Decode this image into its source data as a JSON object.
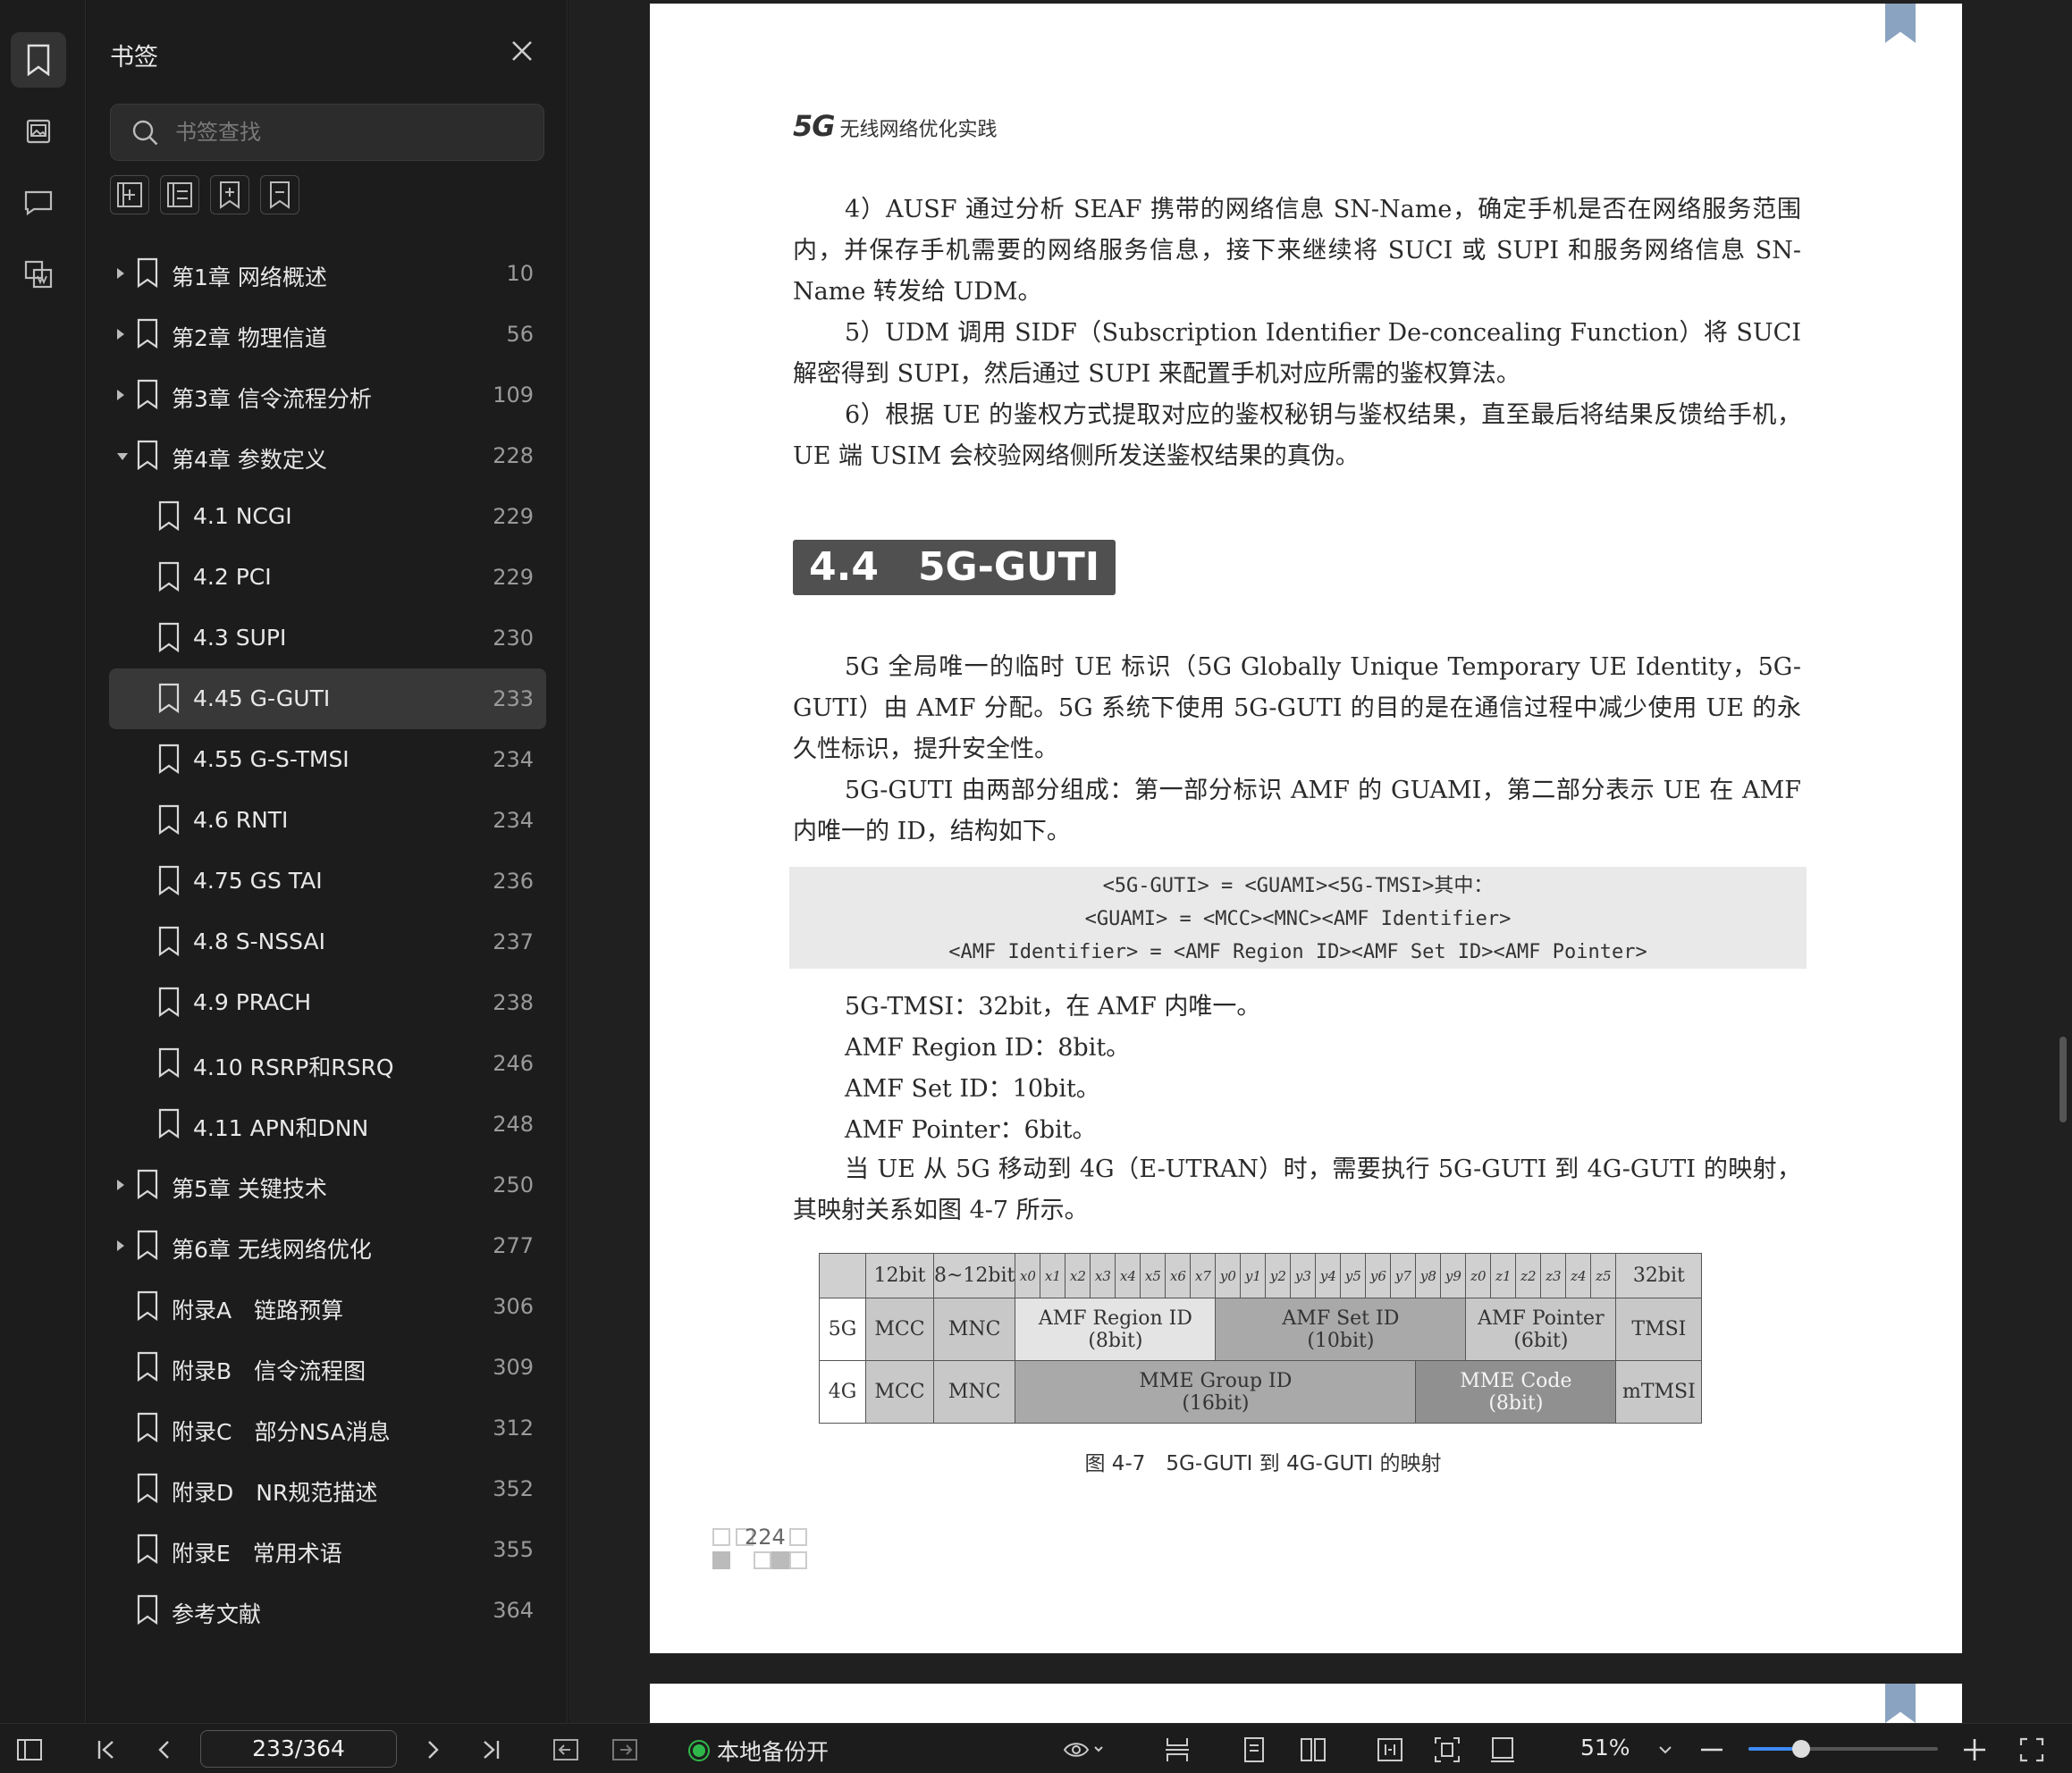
{
  "sidebar": {
    "title": "书签",
    "search_placeholder": "书签查找",
    "items": [
      {
        "label": "第1章 网络概述",
        "page": "10",
        "level": 0,
        "arrow": "right"
      },
      {
        "label": "第2章 物理信道",
        "page": "56",
        "level": 0,
        "arrow": "right"
      },
      {
        "label": "第3章 信令流程分析",
        "page": "109",
        "level": 0,
        "arrow": "right"
      },
      {
        "label": "第4章 参数定义",
        "page": "228",
        "level": 0,
        "arrow": "down"
      },
      {
        "label": "4.1 NCGI",
        "page": "229",
        "level": 1
      },
      {
        "label": "4.2 PCI",
        "page": "229",
        "level": 1
      },
      {
        "label": "4.3 SUPI",
        "page": "230",
        "level": 1
      },
      {
        "label": "4.45 G-GUTI",
        "page": "233",
        "level": 1,
        "selected": true
      },
      {
        "label": "4.55 G-S-TMSI",
        "page": "234",
        "level": 1
      },
      {
        "label": "4.6 RNTI",
        "page": "234",
        "level": 1
      },
      {
        "label": "4.75 GS TAI",
        "page": "236",
        "level": 1
      },
      {
        "label": "4.8 S-NSSAI",
        "page": "237",
        "level": 1
      },
      {
        "label": "4.9 PRACH",
        "page": "238",
        "level": 1
      },
      {
        "label": "4.10 RSRP和RSRQ",
        "page": "246",
        "level": 1
      },
      {
        "label": "4.11 APN和DNN",
        "page": "248",
        "level": 1
      },
      {
        "label": "第5章 关键技术",
        "page": "250",
        "level": 0,
        "arrow": "right"
      },
      {
        "label": "第6章 无线网络优化",
        "page": "277",
        "level": 0,
        "arrow": "right"
      },
      {
        "label": "附录A　链路预算",
        "page": "306",
        "level": 0
      },
      {
        "label": "附录B　信令流程图",
        "page": "309",
        "level": 0
      },
      {
        "label": "附录C　部分NSA消息",
        "page": "312",
        "level": 0
      },
      {
        "label": "附录D　NR规范描述",
        "page": "352",
        "level": 0
      },
      {
        "label": "附录E　常用术语",
        "page": "355",
        "level": 0
      },
      {
        "label": "参考文献",
        "page": "364",
        "level": 0
      }
    ]
  },
  "document": {
    "header_logo": "5G",
    "header_title": "无线网络优化实践",
    "p1": "4）AUSF 通过分析 SEAF 携带的网络信息 SN-Name，确定手机是否在网络服务范围内，并保存手机需要的网络服务信息，接下来继续将 SUCI 或 SUPI 和服务网络信息 SN-Name 转发给 UDM。",
    "p2": "5）UDM 调用 SIDF（Subscription Identifier De-concealing Function）将 SUCI 解密得到 SUPI，然后通过 SUPI 来配置手机对应所需的鉴权算法。",
    "p3": "6）根据 UE 的鉴权方式提取对应的鉴权秘钥与鉴权结果，直至最后将结果反馈给手机，UE 端 USIM 会校验网络侧所发送鉴权结果的真伪。",
    "section_heading": "4.4　5G-GUTI",
    "p4": "5G 全局唯一的临时 UE 标识（5G Globally Unique Temporary UE Identity，5G-GUTI）由 AMF 分配。5G 系统下使用 5G-GUTI 的目的是在通信过程中减少使用 UE 的永久性标识，提升安全性。",
    "p5": "5G-GUTI 由两部分组成：第一部分标识 AMF 的 GUAMI，第二部分表示 UE 在 AMF 内唯一的 ID，结构如下。",
    "code1": "<5G-GUTI> = <GUAMI><5G-TMSI>其中：",
    "code2": "<GUAMI> = <MCC><MNC><AMF Identifier>",
    "code3": "<AMF Identifier> = <AMF Region ID><AMF Set ID><AMF Pointer>",
    "l1": "5G-TMSI：32bit，在 AMF 内唯一。",
    "l2": "AMF Region ID：8bit。",
    "l3": "AMF Set ID：10bit。",
    "l4": "AMF Pointer：6bit。",
    "p6": "当 UE 从 5G 移动到 4G（E-UTRAN）时，需要执行 5G-GUTI 到 4G-GUTI 的映射，其映射关系如图 4-7 所示。",
    "table": {
      "h_12bit": "12bit",
      "h_8_12bit": "8~12bit",
      "h_32bit": "32bit",
      "bits": [
        "x0",
        "x1",
        "x2",
        "x3",
        "x4",
        "x5",
        "x6",
        "x7",
        "y0",
        "y1",
        "y2",
        "y3",
        "y4",
        "y5",
        "y6",
        "y7",
        "y8",
        "y9",
        "z0",
        "z1",
        "z2",
        "z3",
        "z4",
        "z5"
      ],
      "row5g_label": "5G",
      "row4g_label": "4G",
      "mcc": "MCC",
      "mnc": "MNC",
      "amf_region": "AMF Region ID",
      "amf_region_bits": "(8bit)",
      "amf_set": "AMF Set ID",
      "amf_set_bits": "(10bit)",
      "amf_pointer": "AMF Pointer",
      "amf_pointer_bits": "(6bit)",
      "tmsi": "TMSI",
      "mme_group": "MME Group ID",
      "mme_group_bits": "(16bit)",
      "mme_code": "MME Code",
      "mme_code_bits": "(8bit)",
      "mtmsi": "mTMSI"
    },
    "caption": "图 4-7　5G-GUTI 到 4G-GUTI 的映射",
    "page_number": "224"
  },
  "toolbar": {
    "page_indicator": "233/364",
    "backup_label": "本地备份开",
    "zoom_value": "51%",
    "zoom_slider_fraction": 0.28
  }
}
